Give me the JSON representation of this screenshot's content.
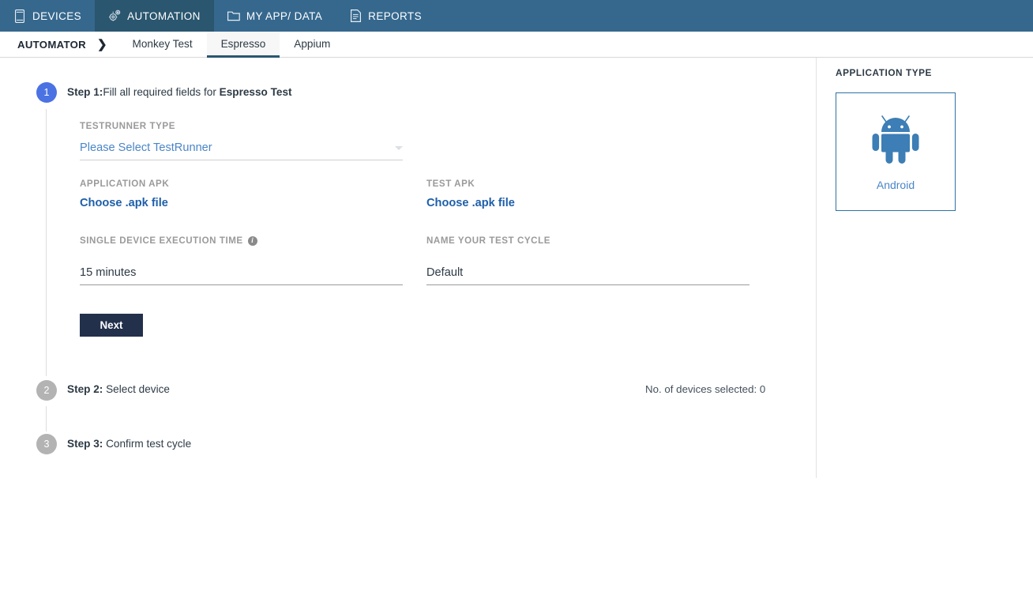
{
  "topnav": {
    "items": [
      {
        "label": "DEVICES",
        "icon": "device-icon",
        "active": false
      },
      {
        "label": "AUTOMATION",
        "icon": "gear-icon",
        "active": true
      },
      {
        "label": "MY APP/ DATA",
        "icon": "folder-icon",
        "active": false
      },
      {
        "label": "REPORTS",
        "icon": "document-icon",
        "active": false
      }
    ],
    "background": "#36688e",
    "active_background": "#2a566f"
  },
  "subnav": {
    "breadcrumb": "AUTOMATOR",
    "chevron": "❯",
    "tabs": [
      {
        "label": "Monkey Test",
        "active": false
      },
      {
        "label": "Espresso",
        "active": true
      },
      {
        "label": "Appium",
        "active": false
      }
    ]
  },
  "steps": [
    {
      "number": "1",
      "prefix": "Step 1:",
      "text": "Fill all required fields for ",
      "emphasis": "Espresso Test",
      "state": "active"
    },
    {
      "number": "2",
      "prefix": "Step 2:",
      "text": "Select device",
      "emphasis": "",
      "state": "inactive"
    },
    {
      "number": "3",
      "prefix": "Step 3:",
      "text": "Confirm test cycle",
      "emphasis": "",
      "state": "inactive"
    }
  ],
  "form": {
    "testrunner": {
      "label": "TESTRUNNER TYPE",
      "value": "Please Select TestRunner"
    },
    "application_apk": {
      "label": "APPLICATION APK",
      "link": "Choose .apk file"
    },
    "test_apk": {
      "label": "TEST APK",
      "link": "Choose .apk file"
    },
    "execution_time": {
      "label": "SINGLE DEVICE EXECUTION TIME",
      "value": "15 minutes",
      "info_glyph": "i"
    },
    "test_cycle_name": {
      "label": "NAME YOUR TEST CYCLE",
      "value": "Default"
    },
    "next_label": "Next"
  },
  "devices_selected": "No. of devices selected: 0",
  "panel": {
    "title": "APPLICATION TYPE",
    "app_type_label": "Android",
    "accent": "#2e72a4",
    "robot_color": "#3c7eb5"
  }
}
